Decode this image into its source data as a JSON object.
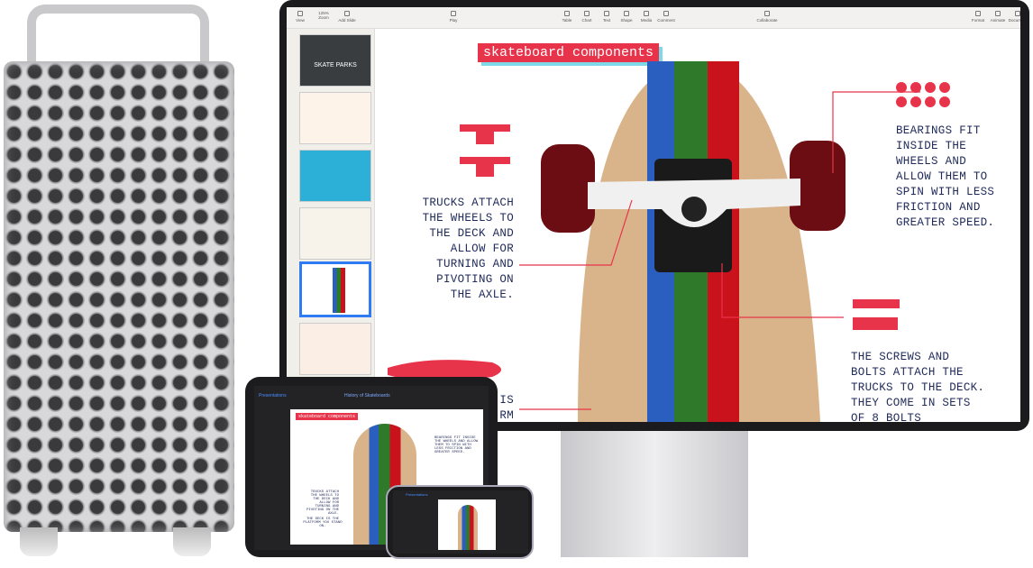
{
  "toolbar": {
    "items": [
      {
        "label": "View",
        "icon": "sidebar-icon"
      },
      {
        "label": "125%",
        "icon": "zoom-dropdown"
      },
      {
        "label": "Add Slide",
        "icon": "plus-icon"
      },
      {
        "label": "Play",
        "icon": "play-icon"
      },
      {
        "label": "Table",
        "icon": "table-icon"
      },
      {
        "label": "Chart",
        "icon": "chart-icon"
      },
      {
        "label": "Text",
        "icon": "text-icon"
      },
      {
        "label": "Shape",
        "icon": "shape-icon"
      },
      {
        "label": "Media",
        "icon": "media-icon"
      },
      {
        "label": "Comment",
        "icon": "comment-icon"
      },
      {
        "label": "Collaborate",
        "icon": "collaborate-icon"
      },
      {
        "label": "Format",
        "icon": "format-icon"
      },
      {
        "label": "Animate",
        "icon": "animate-icon"
      },
      {
        "label": "Document",
        "icon": "document-icon"
      }
    ],
    "zoom_label": "Zoom"
  },
  "slide": {
    "title": "skateboard components",
    "trucks_text": "TRUCKS ATTACH THE WHEELS TO THE DECK AND ALLOW FOR TURNING AND PIVOTING ON THE AXLE.",
    "bearings_text": "BEARINGS FIT INSIDE THE WHEELS AND ALLOW THEM TO SPIN WITH LESS FRICTION AND GREATER SPEED.",
    "screws_text": "THE SCREWS AND BOLTS ATTACH THE TRUCKS TO THE DECK. THEY COME IN SETS OF 8 BOLTS",
    "deck_text": "THE DECK IS THE PLATFORM YOU STAND ON.",
    "deck_text_partial": "IS\nRM"
  },
  "sidebar": {
    "thumb_title": "SKATE PARKS"
  },
  "ipad": {
    "back_label": "Presentations",
    "doc_title": "History of Skateboards"
  },
  "iphone": {
    "back_label": "Presentations"
  },
  "colors": {
    "accent": "#e8344a",
    "text": "#1f2a5a",
    "blue": "#2a5fbf",
    "green": "#2f7a2a",
    "red": "#c9121c"
  }
}
